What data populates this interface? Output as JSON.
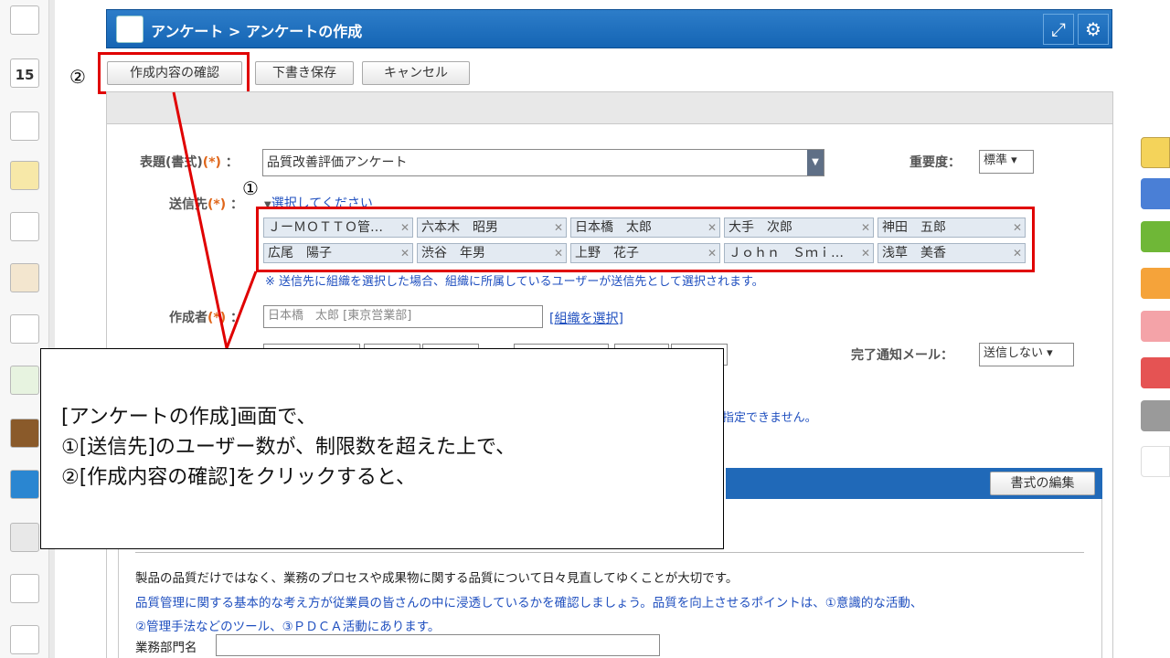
{
  "breadcrumb": "アンケート > アンケートの作成",
  "toolbar": {
    "confirm_label": "作成内容の確認",
    "draft_label": "下書き保存",
    "cancel_label": "キャンセル"
  },
  "markers": {
    "one": "①",
    "two": "②"
  },
  "form": {
    "title_label": "表題(書式)",
    "required_mark": "(*)",
    "colon": "：",
    "title_value": "品質改善評価アンケート",
    "importance_label": "重要度：",
    "importance_value": "標準",
    "recipients_label": "送信先",
    "recipients_select": "選択してください",
    "recipients": [
      "ＪーＭＯＴＴＯ管…",
      "六本木　昭男",
      "日本橋　太郎",
      "大手　次郎",
      "神田　五郎",
      "広尾　陽子",
      "渋谷　年男",
      "上野　花子",
      "Ｊｏｈｎ　Ｓｍｉ…",
      "浅草　美香"
    ],
    "recipients_note": "※ 送信先に組織を選択した場合、組織に所属しているユーザーが送信先として選択されます。",
    "author_label": "作成者",
    "author_value": "日本橋　太郎 [東京営業部]",
    "author_org_link": "[組織を選択]",
    "notify_label": "完了通知メール：",
    "notify_value": "送信しない",
    "period_note_tail": "指定できません。"
  },
  "template": {
    "edit_label": "書式の編集",
    "line1": "製品の品質だけではなく、業務のプロセスや成果物に関する品質について日々見直してゆくことが大切です。",
    "line2": "品質管理に関する基本的な考え方が従業員の皆さんの中に浸透しているかを確認しましょう。品質を向上させるポイントは、①意識的な活動、",
    "line3": "②管理手法などのツール、③ＰＤＣＡ活動にあります。",
    "field_label": "業務部門名"
  },
  "callout": {
    "line1": "[アンケートの作成]画面で、",
    "line2": "①[送信先]のユーザー数が、制限数を超えた上で、",
    "line3": "②[作成内容の確認]をクリックすると、"
  },
  "colors": {
    "header_blue": "#1565b4",
    "highlight_red": "#e00000",
    "link_blue": "#1f4fbf"
  }
}
